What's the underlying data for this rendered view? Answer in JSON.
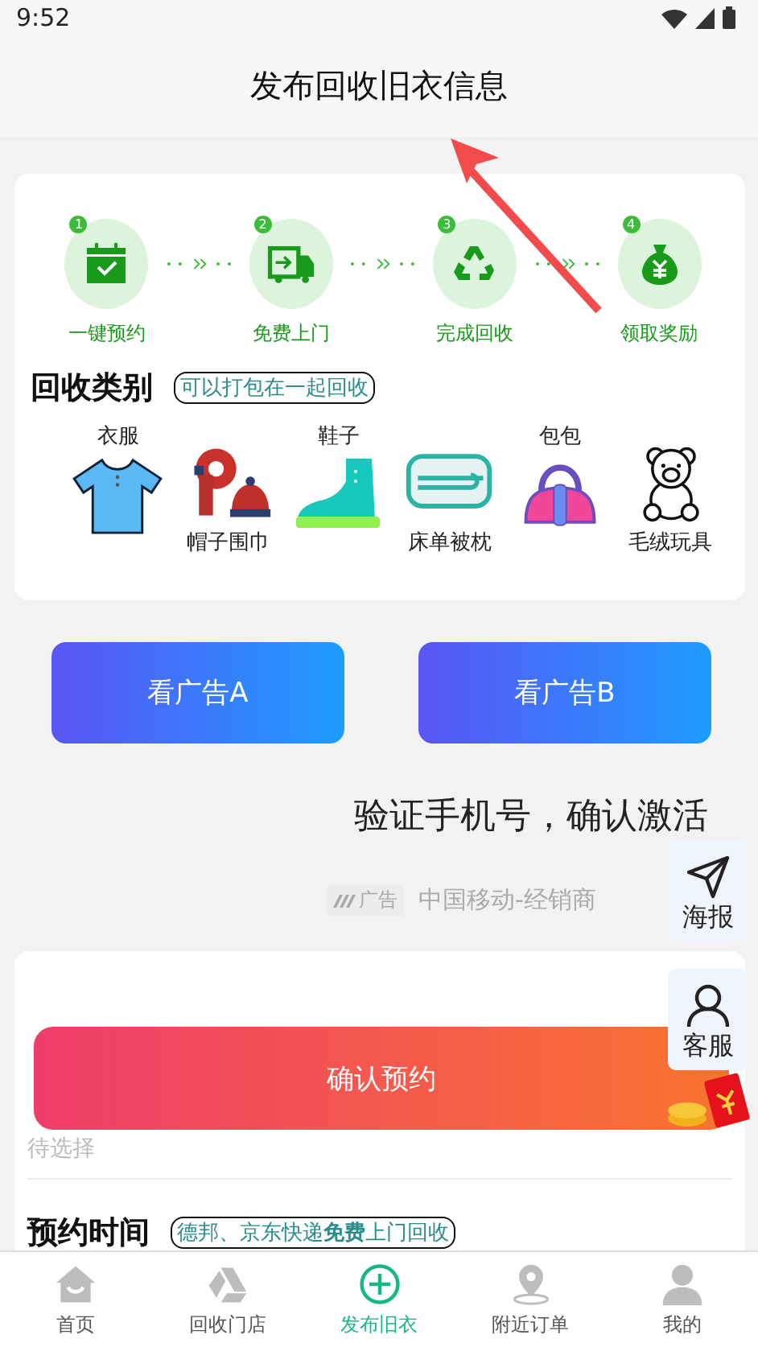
{
  "status_bar": {
    "time": "9:52"
  },
  "header": {
    "title": "发布回收旧衣信息"
  },
  "steps": [
    {
      "number": "1",
      "label": "一键预约",
      "kind": "calendar"
    },
    {
      "number": "2",
      "label": "免费上门",
      "kind": "truck"
    },
    {
      "number": "3",
      "label": "完成回收",
      "kind": "recycle"
    },
    {
      "number": "4",
      "label": "领取奖励",
      "kind": "moneybag"
    }
  ],
  "categories": {
    "title": "回收类别",
    "tag": "可以打包在一起回收",
    "items": [
      {
        "label": "衣服",
        "kind": "shirt"
      },
      {
        "label": "帽子围巾",
        "kind": "scarf"
      },
      {
        "label": "鞋子",
        "kind": "boot"
      },
      {
        "label": "床单被枕",
        "kind": "blanket"
      },
      {
        "label": "包包",
        "kind": "handbag"
      },
      {
        "label": "毛绒玩具",
        "kind": "bear"
      }
    ]
  },
  "ad_buttons": [
    "看广告A",
    "看广告B"
  ],
  "promo": {
    "headline": "验证手机号，确认激活",
    "ad_badge": "广告",
    "advertiser": "中国移动-经销商"
  },
  "side_buttons": [
    {
      "label": "海报",
      "kind": "send"
    },
    {
      "label": "客服",
      "kind": "person"
    }
  ],
  "form": {
    "address_placeholder": "待选择",
    "time_title": "预约时间",
    "time_tag": "德邦、京东快递**免费**上门回收"
  },
  "confirm_button": "确认预约",
  "nav": [
    {
      "label": "首页",
      "kind": "home",
      "selected": false
    },
    {
      "label": "回收门店",
      "kind": "drive",
      "selected": false
    },
    {
      "label": "发布旧衣",
      "kind": "plus",
      "selected": true
    },
    {
      "label": "附近订单",
      "kind": "pin",
      "selected": false
    },
    {
      "label": "我的",
      "kind": "user",
      "selected": false
    }
  ]
}
